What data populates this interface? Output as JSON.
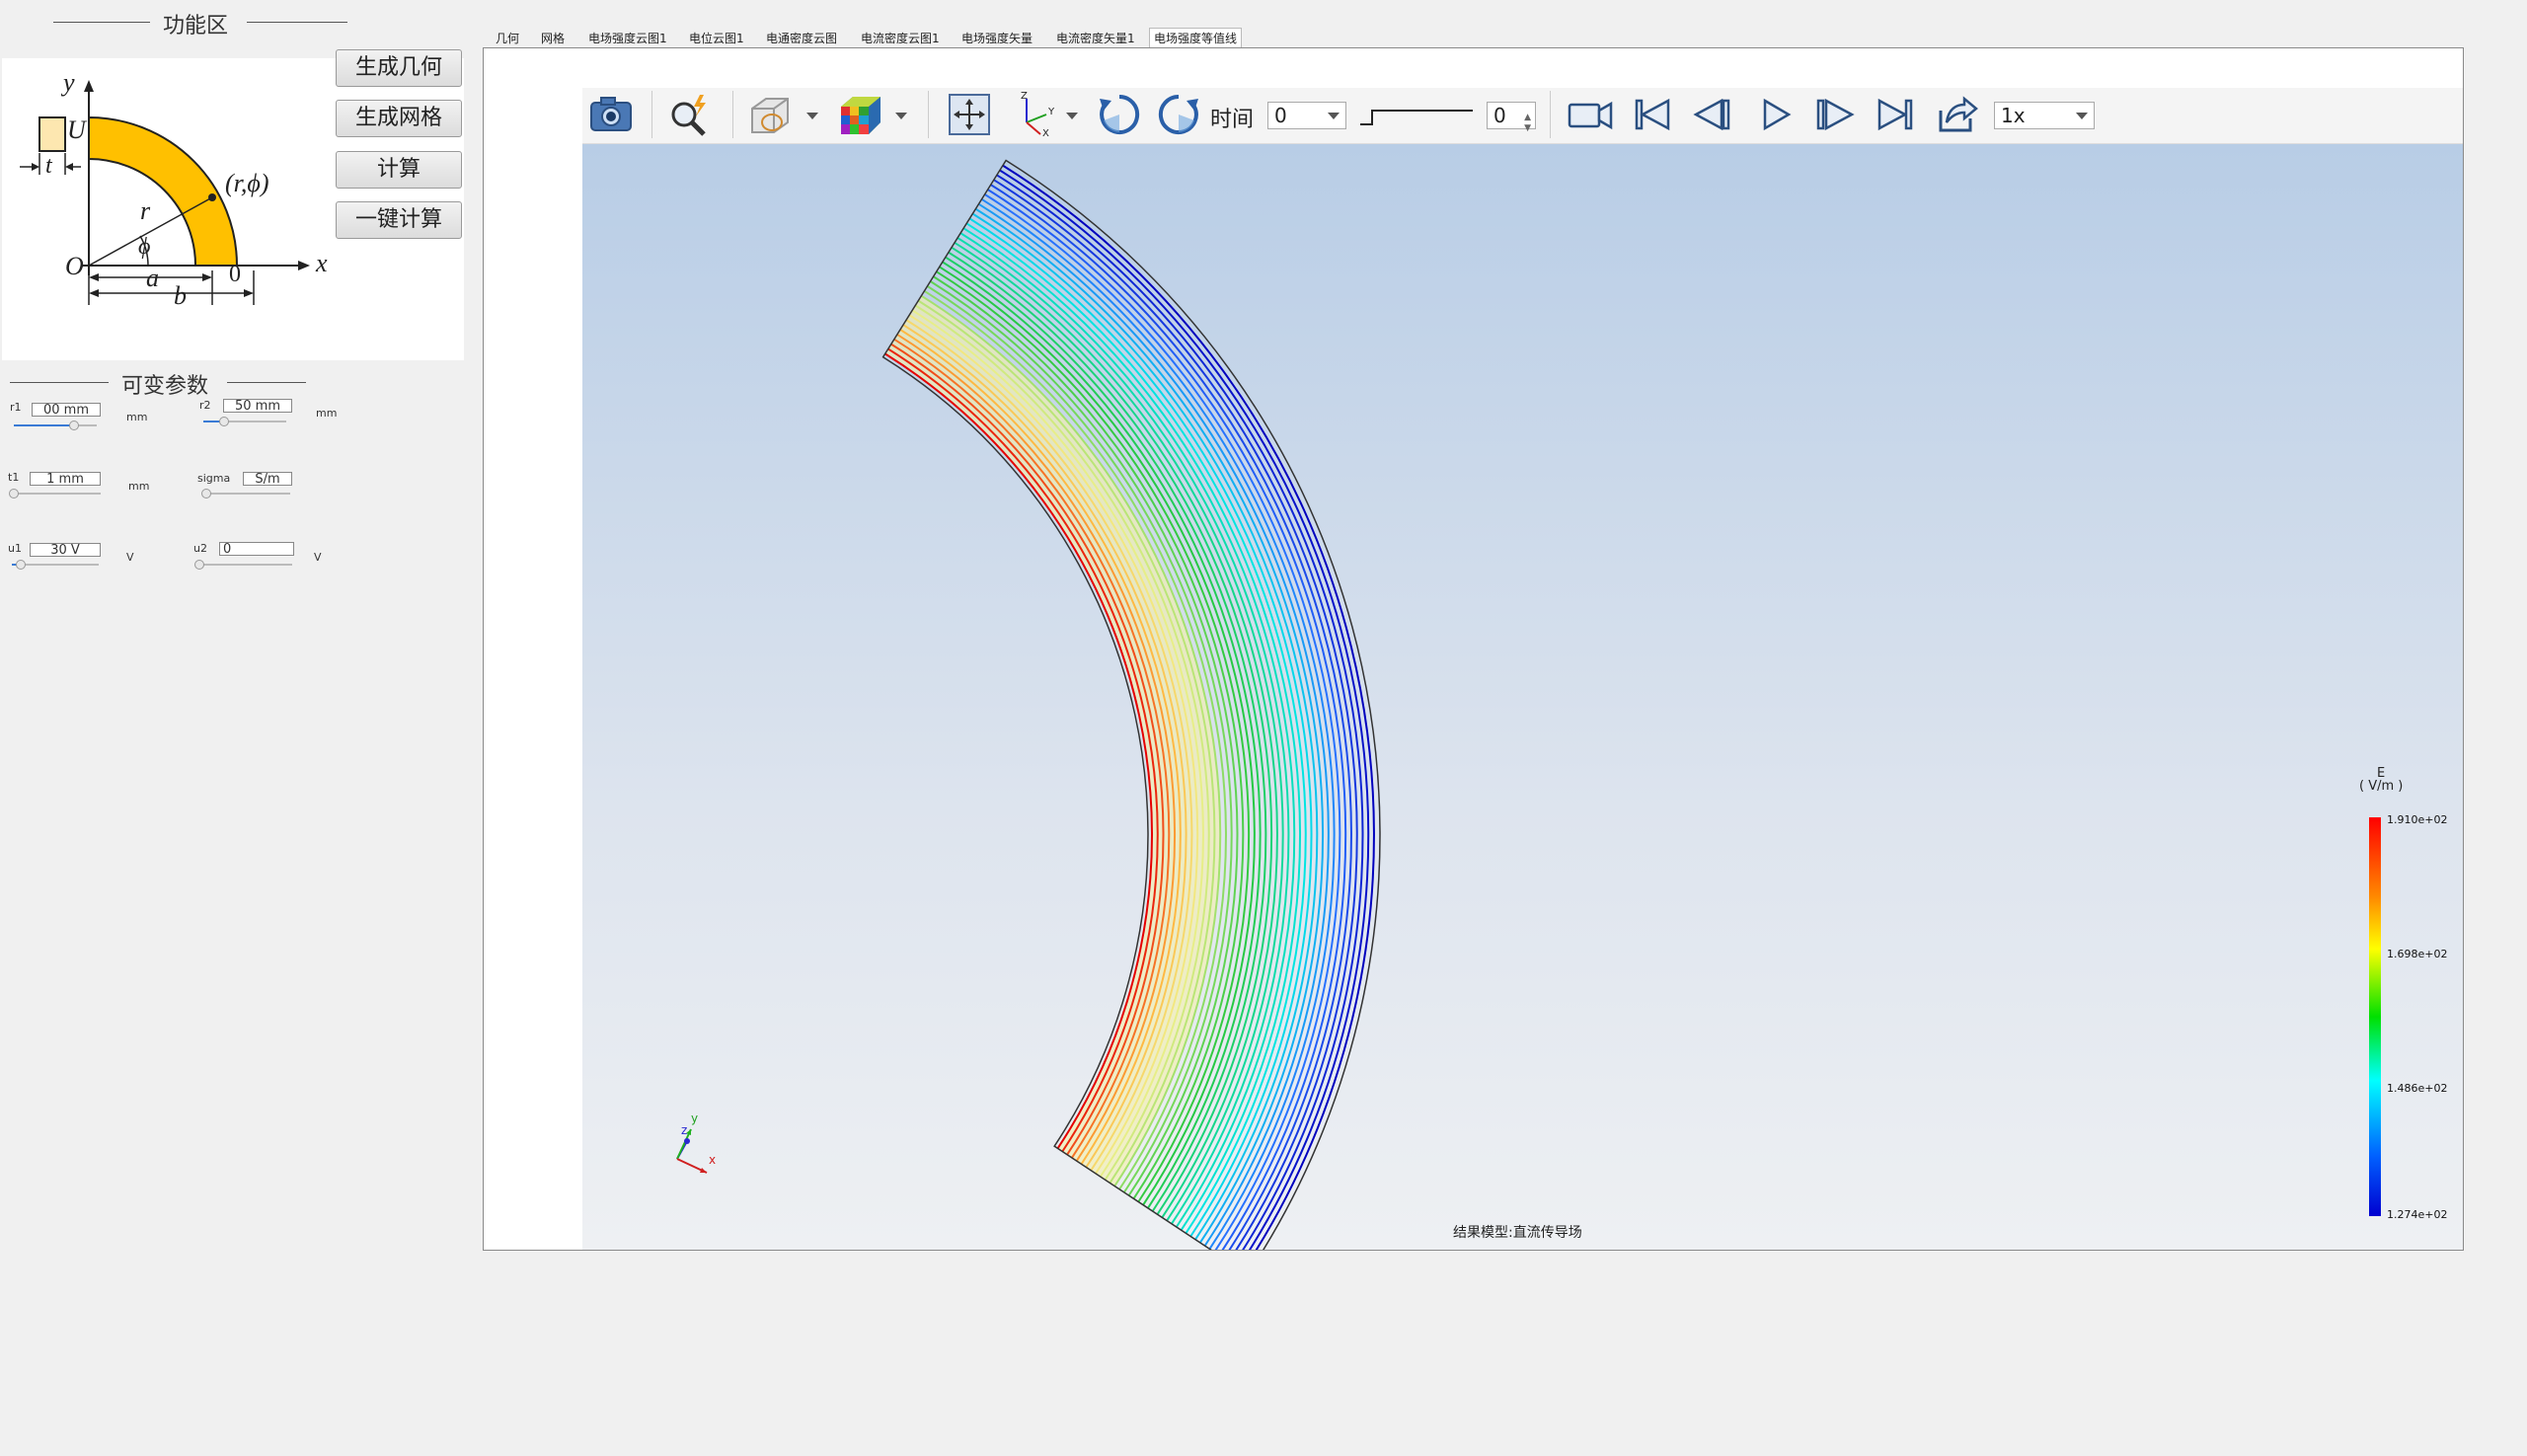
{
  "function_area": {
    "title": "功能区",
    "buttons": [
      "生成几何",
      "生成网格",
      "计算",
      "一键计算"
    ],
    "diagram_labels": {
      "y": "y",
      "x": "x",
      "U": "U",
      "t": "t",
      "r": "r",
      "phi": "ϕ",
      "point": "(r,ϕ)",
      "O": "O",
      "a": "a",
      "b": "b",
      "zero": "0"
    }
  },
  "params": {
    "title": "可变参数",
    "items": [
      {
        "label": "r1",
        "value": "00 mm",
        "unit": "mm",
        "slider": 0.7
      },
      {
        "label": "r2",
        "value": "50 mm",
        "unit": "mm",
        "slider": 0.2
      },
      {
        "label": "t1",
        "value": "1 mm",
        "unit": "mm",
        "slider": 0.0
      },
      {
        "label": "sigma",
        "value": "S/m",
        "unit": "",
        "slider": 0.0
      },
      {
        "label": "u1",
        "value": "30 V",
        "unit": "V",
        "slider": 0.1
      },
      {
        "label": "u2",
        "value": "0",
        "unit": "V",
        "slider": 0.0
      }
    ]
  },
  "tabs": [
    "几何",
    "网格",
    "电场强度云图1",
    "电位云图1",
    "电通密度云图",
    "电流密度云图1",
    "电场强度矢量",
    "电流密度矢量1",
    "电场强度等值线"
  ],
  "active_tab": 8,
  "toolbar": {
    "icons": [
      "camera-icon",
      "zoom-icon",
      "display-mode-icon",
      "color-cube-icon",
      "fit-view-icon",
      "axis-orientation-icon",
      "rotate-cw-icon",
      "rotate-ccw-icon",
      "record-icon",
      "first-frame-icon",
      "prev-frame-icon",
      "play-icon",
      "next-frame-icon",
      "last-frame-icon",
      "export-icon"
    ],
    "time_label": "时间",
    "time_value": "0",
    "frame_value": "0",
    "speed_value": "1x"
  },
  "viewport": {
    "footer": "结果模型:直流传导场",
    "axis_labels": {
      "x": "x",
      "y": "y",
      "z": "z"
    },
    "legend": {
      "title": "E",
      "unit": "( V/m )",
      "ticks": [
        "1.910e+02",
        "1.698e+02",
        "1.486e+02",
        "1.274e+02"
      ]
    }
  }
}
